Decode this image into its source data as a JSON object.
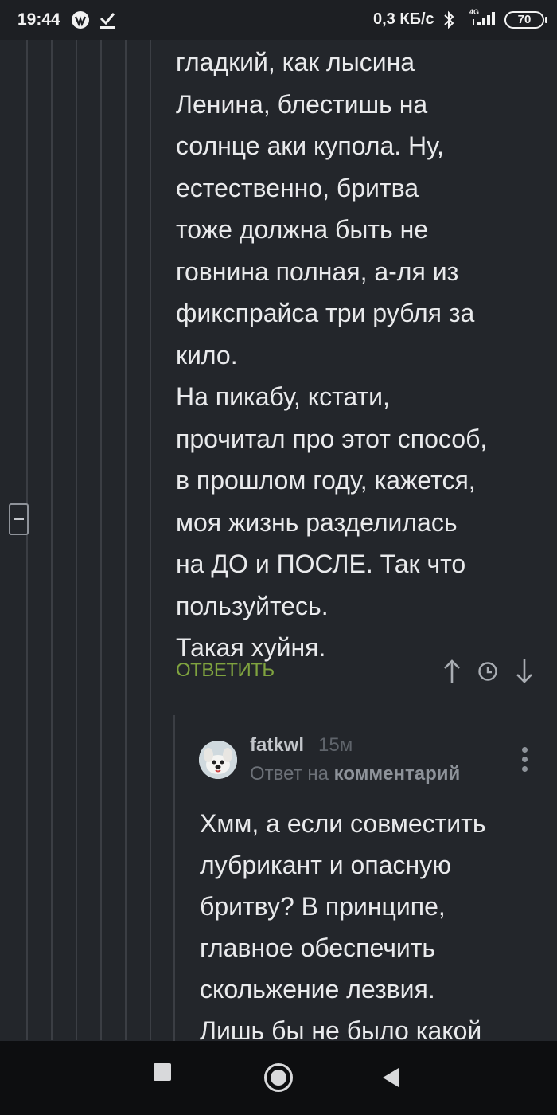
{
  "status_bar": {
    "time": "19:44",
    "net_speed": "0,3 КБ/с",
    "network_type": "4G",
    "battery": "70",
    "icons": [
      "app-notification-icon",
      "download-done-icon",
      "bluetooth-icon",
      "signal-icon"
    ]
  },
  "comment": {
    "lines": [
      "гладкий, как лысина",
      "Ленина, блестишь на",
      "солнце аки купола. Ну,",
      "естественно, бритва",
      "тоже должна быть не",
      "говнина полная, а-ля из",
      "фикспрайса три рубля за",
      "кило.",
      "На пикабу, кстати,",
      "прочитал про этот способ,",
      "в прошлом году, кажется,",
      "моя жизнь разделилась",
      "на ДО и ПОСЛЕ. Так что",
      "пользуйтесь.",
      "Такая хуйня."
    ],
    "reply_label": "ОТВЕТИТЬ",
    "actions": [
      "arrow-up-icon",
      "clock-icon",
      "arrow-down-icon"
    ],
    "collapse_icon": "minus-icon"
  },
  "reply": {
    "username": "fatkwl",
    "time": "15м",
    "reply_to_prefix": "Ответ на",
    "reply_to_target": "комментарий",
    "lines": [
      "Хмм, а если совместить",
      "лубрикант и опасную",
      "бритву? В принципе,",
      "главное обеспечить",
      "скольжение лезвия.",
      "Лишь бы не было какой"
    ]
  },
  "colors": {
    "background": "#23262b",
    "text": "#e9eaec",
    "accent_green": "#7fa33f",
    "thread_line": "#3b3e44"
  }
}
